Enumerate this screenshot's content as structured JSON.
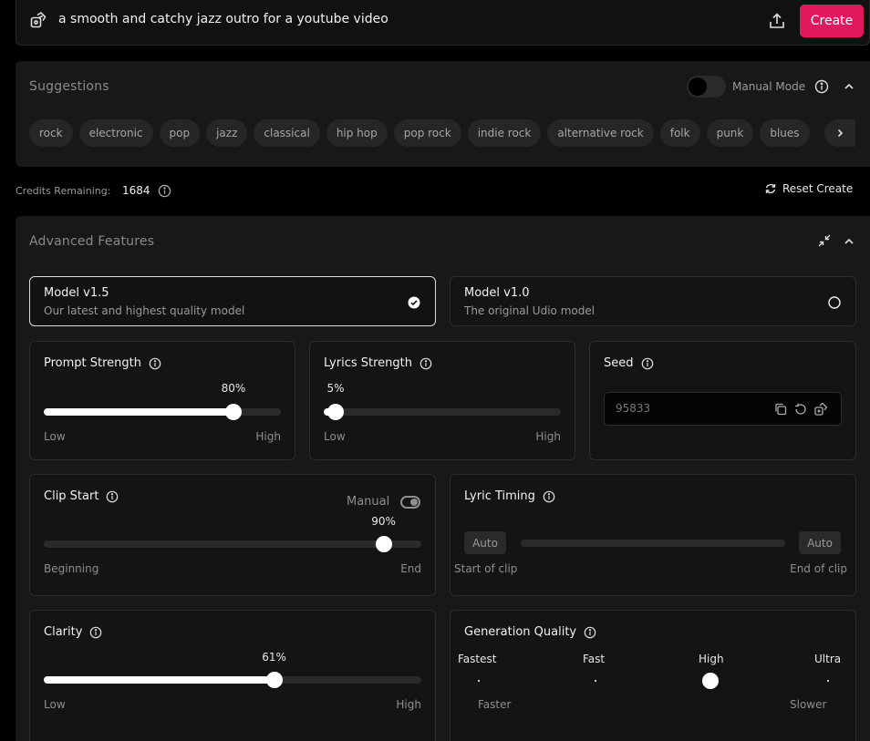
{
  "prompt": {
    "text": "a smooth and catchy jazz outro for a youtube video",
    "create_label": "Create"
  },
  "suggestions": {
    "title": "Suggestions",
    "manual_mode_label": "Manual Mode",
    "tags": [
      "rock",
      "electronic",
      "pop",
      "jazz",
      "classical",
      "hip hop",
      "pop rock",
      "indie rock",
      "alternative rock",
      "folk",
      "punk",
      "blues"
    ]
  },
  "credits": {
    "label": "Credits Remaining:",
    "value": "1684",
    "reset_label": "Reset Create"
  },
  "advanced": {
    "title": "Advanced Features",
    "models": [
      {
        "name": "Model v1.5",
        "desc": "Our latest and highest quality model",
        "selected": true
      },
      {
        "name": "Model v1.0",
        "desc": "The original Udio model",
        "selected": false
      }
    ],
    "prompt_strength": {
      "title": "Prompt Strength",
      "value_label": "80%",
      "value": 0.8,
      "low": "Low",
      "high": "High"
    },
    "lyrics_strength": {
      "title": "Lyrics Strength",
      "value_label": "5%",
      "value": 0.05,
      "low": "Low",
      "high": "High"
    },
    "seed": {
      "title": "Seed",
      "placeholder": "95833"
    },
    "clip_start": {
      "title": "Clip Start",
      "manual_label": "Manual",
      "value_label": "90%",
      "value": 0.9,
      "low": "Beginning",
      "high": "End"
    },
    "lyric_timing": {
      "title": "Lyric Timing",
      "auto_left": "Auto",
      "auto_right": "Auto",
      "low": "Start of clip",
      "high": "End of clip"
    },
    "clarity": {
      "title": "Clarity",
      "value_label": "61%",
      "value": 0.61,
      "low": "Low",
      "high": "High"
    },
    "generation_quality": {
      "title": "Generation Quality",
      "levels": [
        "Fastest",
        "Fast",
        "High",
        "Ultra"
      ],
      "selected": "High",
      "low": "Faster",
      "high": "Slower"
    }
  },
  "colors": {
    "accent": "#e0195f",
    "panel": "#181818",
    "card": "#141414"
  }
}
